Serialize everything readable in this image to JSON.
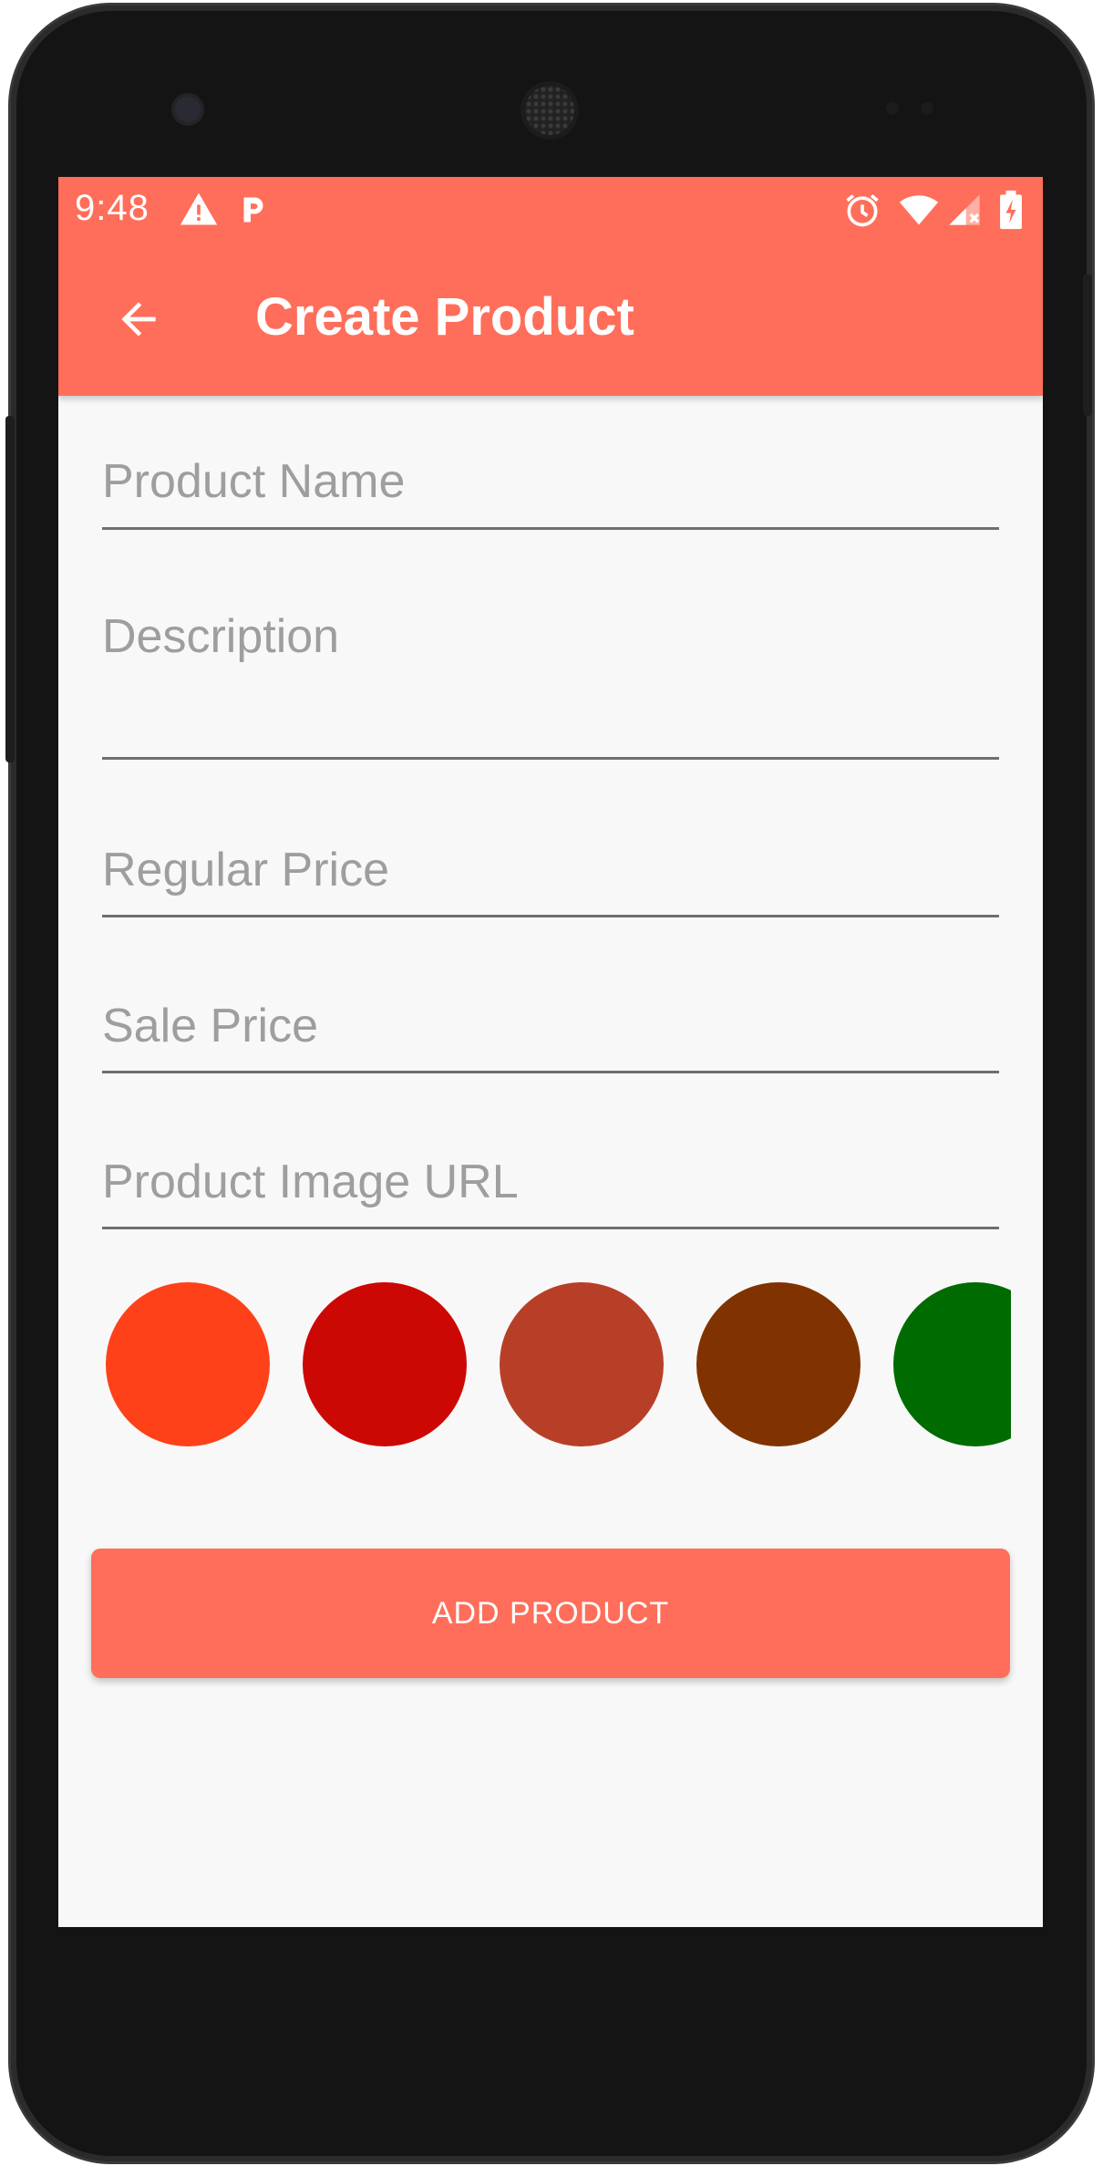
{
  "status_bar": {
    "time": "9:48",
    "icons": [
      "warning-icon",
      "parking-icon",
      "alarm-icon",
      "wifi-icon",
      "signal-icon",
      "battery-charging-icon"
    ]
  },
  "app_bar": {
    "title": "Create Product",
    "back_icon": "arrow-back-icon"
  },
  "form": {
    "product_name": {
      "placeholder": "Product Name",
      "value": ""
    },
    "description": {
      "placeholder": "Description",
      "value": ""
    },
    "regular_price": {
      "placeholder": "Regular Price",
      "value": ""
    },
    "sale_price": {
      "placeholder": "Sale Price",
      "value": ""
    },
    "image_url": {
      "placeholder": "Product Image URL",
      "value": ""
    }
  },
  "color_swatches": [
    "#ff4119",
    "#cc0805",
    "#b83f27",
    "#803300",
    "#006b00"
  ],
  "add_button_label": "ADD PRODUCT",
  "colors": {
    "accent": "#ff6e5a",
    "background": "#f8f8f8",
    "placeholder": "#9e9e9e"
  }
}
